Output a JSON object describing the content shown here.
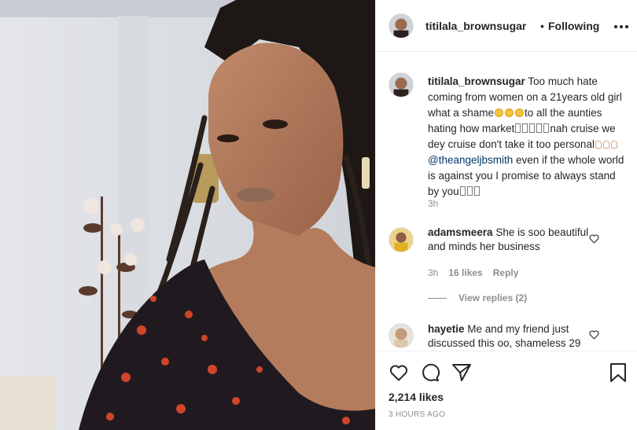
{
  "post": {
    "username": "titilala_brownsugar",
    "follow_separator": "•",
    "follow_status": "Following",
    "more_icon": "more-horizontal-icon"
  },
  "caption": {
    "username": "titilala_brownsugar",
    "text_1": "Too much hate coming from women on a 21years old girl what a shame",
    "text_2": "to all the aunties hating how market",
    "text_3": "nah cruise we dey cruise don't take it too personal",
    "mention": "@theangeljbsmith",
    "text_4": "even if the whole world is against you I promise to always stand by you",
    "time": "3h"
  },
  "comments": [
    {
      "username": "adamsmeera",
      "text": "She is soo beautiful and minds her business",
      "time": "3h",
      "likes": "16 likes",
      "reply": "Reply",
      "view_replies": "View replies (2)"
    },
    {
      "username": "hayetie",
      "text": "Me and my friend just discussed this oo, shameless 29"
    }
  ],
  "actions": {
    "like_icon": "heart-icon",
    "comment_icon": "comment-icon",
    "share_icon": "share-icon",
    "save_icon": "bookmark-icon"
  },
  "likes_count": "2,214 likes",
  "posted_ago": "3 HOURS AGO",
  "colors": {
    "text": "#262626",
    "muted": "#8e8e8e",
    "mention": "#00376b",
    "border": "#efefef"
  }
}
